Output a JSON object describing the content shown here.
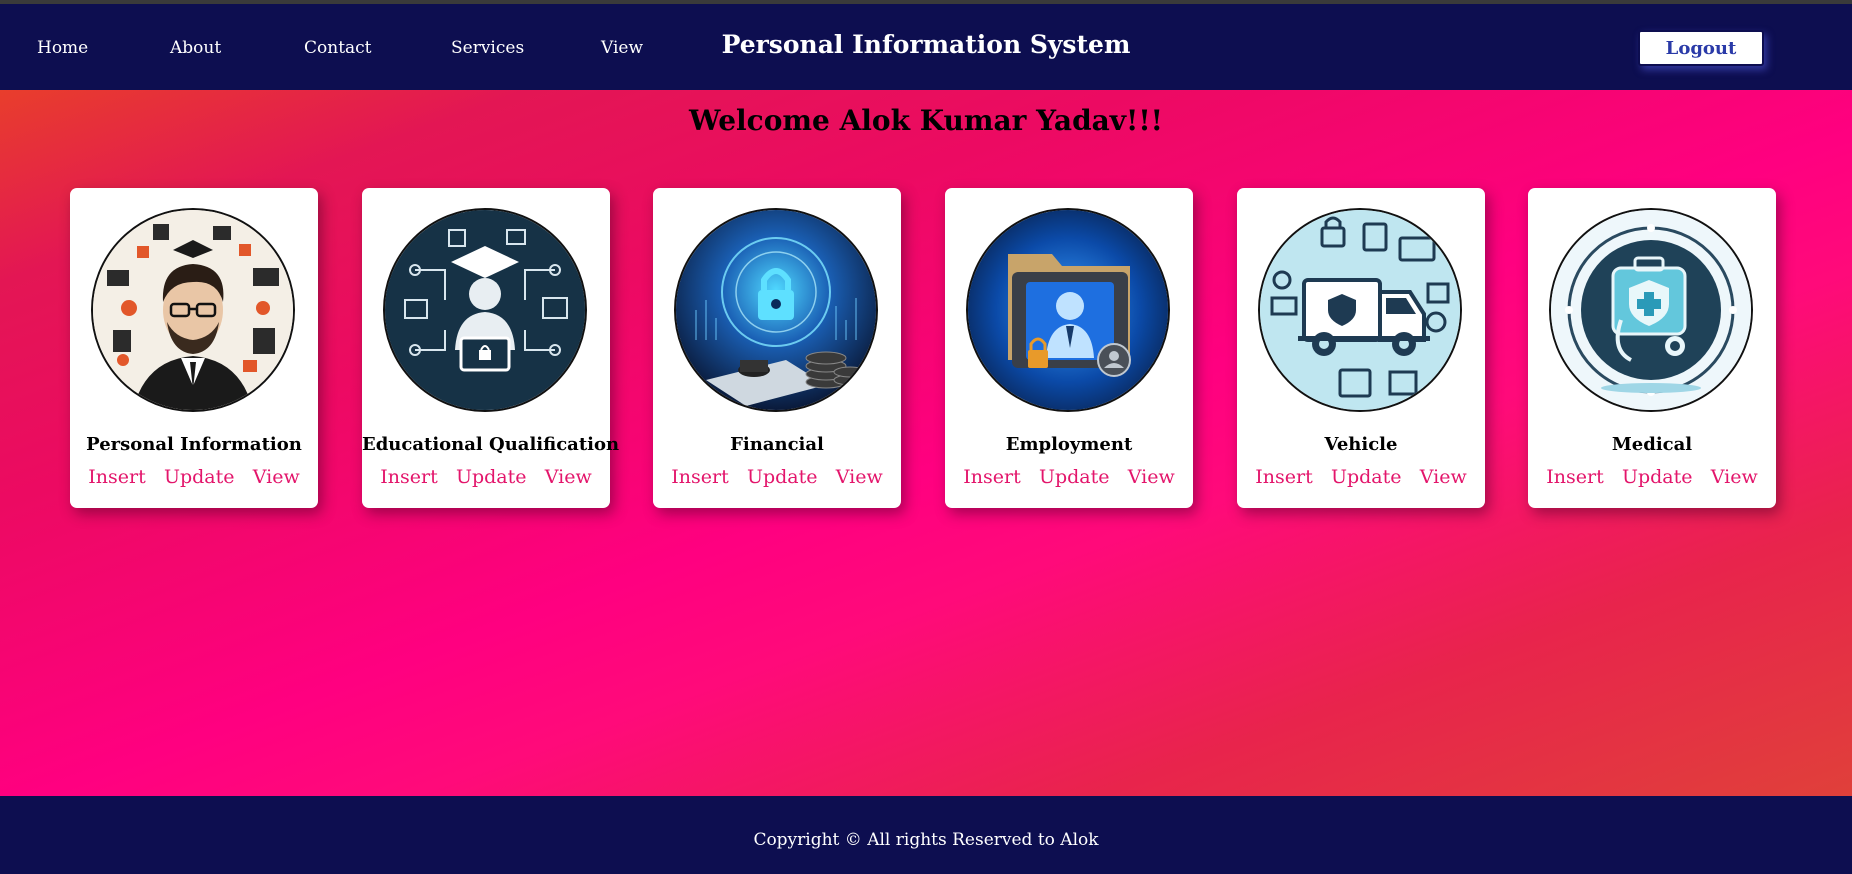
{
  "nav": {
    "items": [
      {
        "label": "Home"
      },
      {
        "label": "About"
      },
      {
        "label": "Contact"
      },
      {
        "label": "Services"
      },
      {
        "label": "View"
      }
    ],
    "title": "Personal Information System",
    "logout_label": "Logout"
  },
  "main": {
    "welcome": "Welcome Alok Kumar Yadav!!!",
    "cards": [
      {
        "title": "Personal Information",
        "icon": "person-portrait-icon",
        "insert": "Insert",
        "update": "Update",
        "view": "View"
      },
      {
        "title": "Educational Qualification",
        "icon": "graduate-icon",
        "insert": "Insert",
        "update": "Update",
        "view": "View"
      },
      {
        "title": "Financial",
        "icon": "finance-lock-icon",
        "insert": "Insert",
        "update": "Update",
        "view": "View"
      },
      {
        "title": "Employment",
        "icon": "employee-folder-icon",
        "insert": "Insert",
        "update": "Update",
        "view": "View"
      },
      {
        "title": "Vehicle",
        "icon": "vehicle-truck-icon",
        "insert": "Insert",
        "update": "Update",
        "view": "View"
      },
      {
        "title": "Medical",
        "icon": "medical-kit-icon",
        "insert": "Insert",
        "update": "Update",
        "view": "View"
      }
    ]
  },
  "footer": {
    "copyright": "Copyright © All rights Reserved to Alok"
  },
  "colors": {
    "navbar": "#0d0e50",
    "link_accent": "#e3156b",
    "background_pink": "#ff0080",
    "background_red": "#e0403a",
    "logout_text": "#2a3aa8"
  }
}
